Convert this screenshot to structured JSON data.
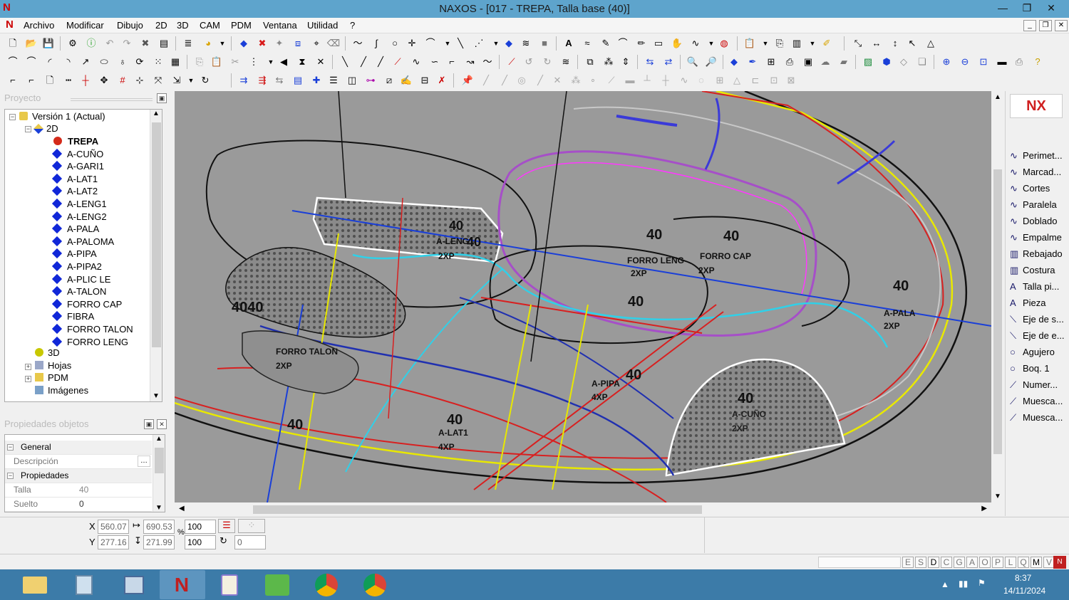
{
  "window": {
    "title": "NAXOS - [017 - TREPA, Talla base (40)]",
    "controls": [
      "—",
      "❐",
      "✕"
    ]
  },
  "menubar": {
    "items": [
      "Archivo",
      "Modificar",
      "Dibujo",
      "2D",
      "3D",
      "CAM",
      "PDM",
      "Ventana",
      "Utilidad",
      "?"
    ],
    "mdi_controls": [
      "_",
      "❐",
      "✕"
    ]
  },
  "left_panel": {
    "project_header": "Proyecto",
    "tree": {
      "root": "Versión 1 (Actual)",
      "node_2d": "2D",
      "pieces": [
        "TREPA",
        "A-CUÑO",
        "A-GARI1",
        "A-LAT1",
        "A-LAT2",
        "A-LENG1",
        "A-LENG2",
        "A-PALA",
        "A-PALOMA",
        "A-PIPA",
        "A-PIPA2",
        "A-PLIC LE",
        "A-TALON",
        "FORRO CAP",
        "FIBRA",
        "FORRO TALON",
        "FORRO LENG"
      ],
      "others": [
        "3D",
        "Hojas",
        "PDM",
        "Imágenes"
      ]
    },
    "props_header": "Propiedades objetos",
    "props": {
      "group_general": "General",
      "descripcion_label": "Descripción",
      "descripcion_value": "",
      "group_propiedades": "Propiedades",
      "talla_label": "Talla",
      "talla_value": "40",
      "suelto_label": "Suelto",
      "suelto_value": "0"
    }
  },
  "canvas": {
    "labels": [
      {
        "text": "40",
        "name": "lbl-40-leng1"
      },
      {
        "text": "A-LENG1",
        "name": "lbl-aleng1"
      },
      {
        "text": "40",
        "name": "lbl-40-leng1b"
      },
      {
        "text": "2XP",
        "name": "lbl-2xp-leng1"
      },
      {
        "text": "40",
        "name": "lbl-40-forroleng"
      },
      {
        "text": "FORRO LENG",
        "name": "lbl-forroleng"
      },
      {
        "text": "2XP",
        "name": "lbl-2xp-forroleng"
      },
      {
        "text": "40",
        "name": "lbl-40-forrocap"
      },
      {
        "text": "FORRO CAP",
        "name": "lbl-forrocap"
      },
      {
        "text": "2XP",
        "name": "lbl-2xp-forrocap"
      },
      {
        "text": "40",
        "name": "lbl-40-pala"
      },
      {
        "text": "A-PALA",
        "name": "lbl-apala"
      },
      {
        "text": "2XP",
        "name": "lbl-2xp-pala"
      },
      {
        "text": "4040",
        "name": "lbl-4040-talon"
      },
      {
        "text": "FORRO TALON",
        "name": "lbl-forrotalon"
      },
      {
        "text": "2XP",
        "name": "lbl-2xp-talon"
      },
      {
        "text": "40",
        "name": "lbl-40-center"
      },
      {
        "text": "40",
        "name": "lbl-40-pipa"
      },
      {
        "text": "A-PIPA",
        "name": "lbl-apipa"
      },
      {
        "text": "4XP",
        "name": "lbl-4xp-pipa"
      },
      {
        "text": "40",
        "name": "lbl-40-lat1"
      },
      {
        "text": "A-LAT1",
        "name": "lbl-alat1"
      },
      {
        "text": "4XP",
        "name": "lbl-4xp-lat1"
      },
      {
        "text": "40",
        "name": "lbl-40-cuno"
      },
      {
        "text": "A-CUÑO",
        "name": "lbl-acuno"
      },
      {
        "text": "2XP",
        "name": "lbl-2xp-cuno"
      },
      {
        "text": "40",
        "name": "lbl-40-left"
      }
    ]
  },
  "right_panel": {
    "tools": [
      "Perimet...",
      "Marcad...",
      "Cortes",
      "Paralela",
      "Doblado",
      "Empalme",
      "Rebajado",
      "Costura",
      "Talla pi...",
      "Pieza",
      "Eje de s...",
      "Eje de e...",
      "Agujero",
      "Boq. 1",
      "Numer...",
      "Muesca...",
      "Muesca..."
    ],
    "tool_icons": [
      "curve-icon",
      "curve-icon",
      "curve-icon",
      "parallel-icon",
      "fold-icon",
      "fillet-icon",
      "skive-icon",
      "stitch-icon",
      "text-icon",
      "text-icon",
      "axis-icon",
      "axis-icon",
      "circle-icon",
      "circle-icon",
      "pen-icon",
      "notch-icon",
      "notch-icon"
    ]
  },
  "coords": {
    "x_label": "X",
    "y_label": "Y",
    "x": "560.07",
    "y": "277.16",
    "w": "690.53",
    "h": "271.99",
    "scale_x": "100",
    "scale_y": "100",
    "percent": "%",
    "rotation": "0"
  },
  "status": {
    "flags": [
      "E",
      "S",
      "D",
      "C",
      "G",
      "A",
      "O",
      "P",
      "L",
      "Q",
      "M",
      "V"
    ]
  },
  "taskbar": {
    "time": "8:37",
    "date": "14/11/2024"
  },
  "colors": {
    "titlebar": "#5ea4cc",
    "canvas": "#9a9a9a",
    "taskbar": "#3c7ba8"
  }
}
